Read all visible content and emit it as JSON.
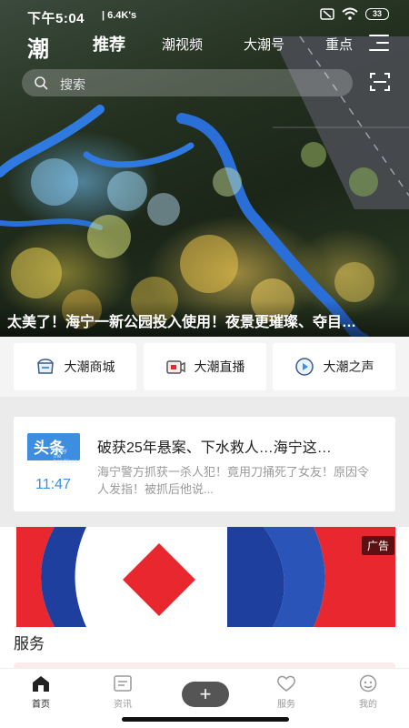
{
  "status_bar": {
    "time": "下午5:04",
    "network": "| 6.4K's",
    "battery": "33"
  },
  "app": {
    "logo": "潮"
  },
  "tabs": [
    {
      "label": "推荐",
      "active": true
    },
    {
      "label": "潮视频",
      "active": false
    },
    {
      "label": "大潮号",
      "active": false
    },
    {
      "label": "重点",
      "active": false
    }
  ],
  "search": {
    "placeholder": "搜索"
  },
  "hero": {
    "caption": "太美了！海宁一新公园投入使用！夜景更璀璨、夺目…"
  },
  "quick_links": [
    {
      "label": "大潮商城",
      "icon": "shop-icon"
    },
    {
      "label": "大潮直播",
      "icon": "live-icon"
    },
    {
      "label": "大潮之声",
      "icon": "play-icon"
    }
  ],
  "headline": {
    "badge": "头条",
    "badge_sub_line1": "today",
    "badge_sub_line2": "the headlines",
    "time": "11:47",
    "title": "破获25年悬案、下水救人…海宁这…",
    "summary": "海宁警方抓获一杀人犯！竟用刀捅死了女友！原因令人发指！被抓后他说..."
  },
  "ad": {
    "tag": "广告"
  },
  "services": {
    "title": "服务"
  },
  "bottom_nav": [
    {
      "label": "首页",
      "icon": "home-icon",
      "active": true
    },
    {
      "label": "资讯",
      "icon": "news-icon",
      "active": false
    },
    {
      "label": "服务",
      "icon": "heart-icon",
      "active": false
    },
    {
      "label": "我的",
      "icon": "profile-icon",
      "active": false
    }
  ],
  "colors": {
    "accent_blue": "#3d8ee0",
    "plus_button": "#555555",
    "ad_red": "#e8282e",
    "ad_blue": "#1e3f9e"
  }
}
